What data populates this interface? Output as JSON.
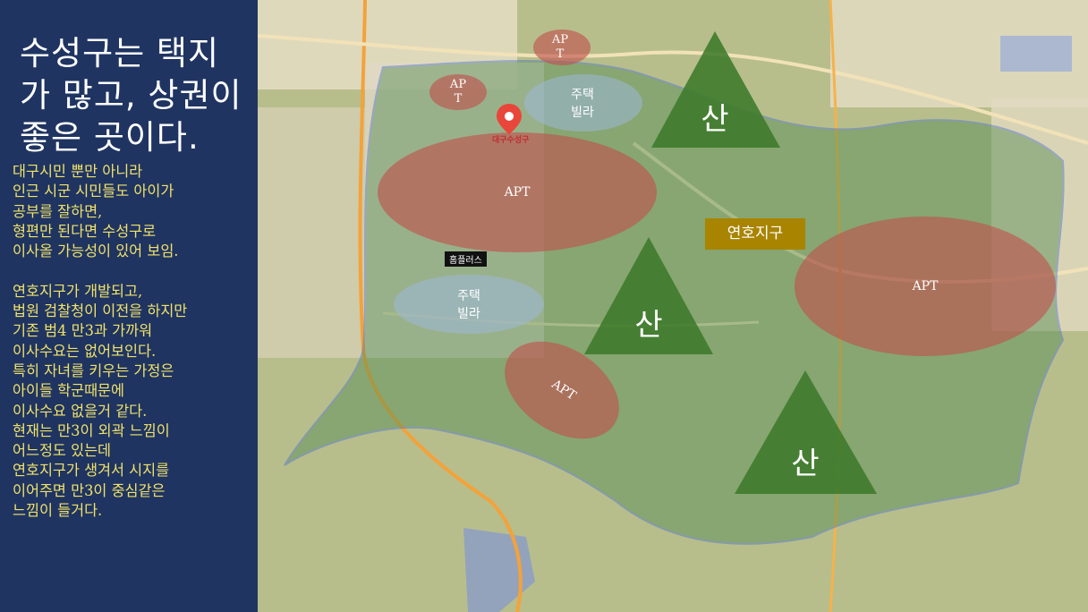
{
  "sidebar": {
    "title": "수성구는 택지가 많고, 상권이 좋은 곳이다.",
    "notes": "대구시민 뿐만 아니라\n인근 시군 시민들도 아이가\n공부를 잘하면,\n형편만 된다면 수성구로\n이사올 가능성이 있어 보임.\n\n연호지구가 개발되고,\n법원 검찰청이 이전을 하지만\n기존 범4 만3과 가까워\n이사수요는 없어보인다.\n특히 자녀를 키우는 가정은\n아이들 학군때문에\n이사수요 없을거 같다.\n현재는 만3이 외곽 느낌이\n어느정도 있는데\n연호지구가 생겨서 시지를\n이어주면 만3이 중심같은\n느낌이 들거다."
  },
  "map": {
    "district_badge": "연호지구",
    "place_tag": "홈플러스",
    "pin_label": "대구수성구",
    "apt_main": "APT",
    "apt_east": "APT",
    "apt_south": "APT",
    "apt_small_1": "AP\nT",
    "apt_small_2": "AP\nT",
    "villa_north": "주택\n빌라",
    "villa_south": "주택\n빌라",
    "mountain_1": "산",
    "mountain_2": "산",
    "mountain_3": "산"
  },
  "colors": {
    "sidebar_bg": "#1f3461",
    "title": "#ffffff",
    "notes": "#f0e26a",
    "apt_overlay": "#c0504d",
    "villa_overlay": "#9db6d8",
    "mountain": "#3d7a2a",
    "badge": "#a88400"
  }
}
